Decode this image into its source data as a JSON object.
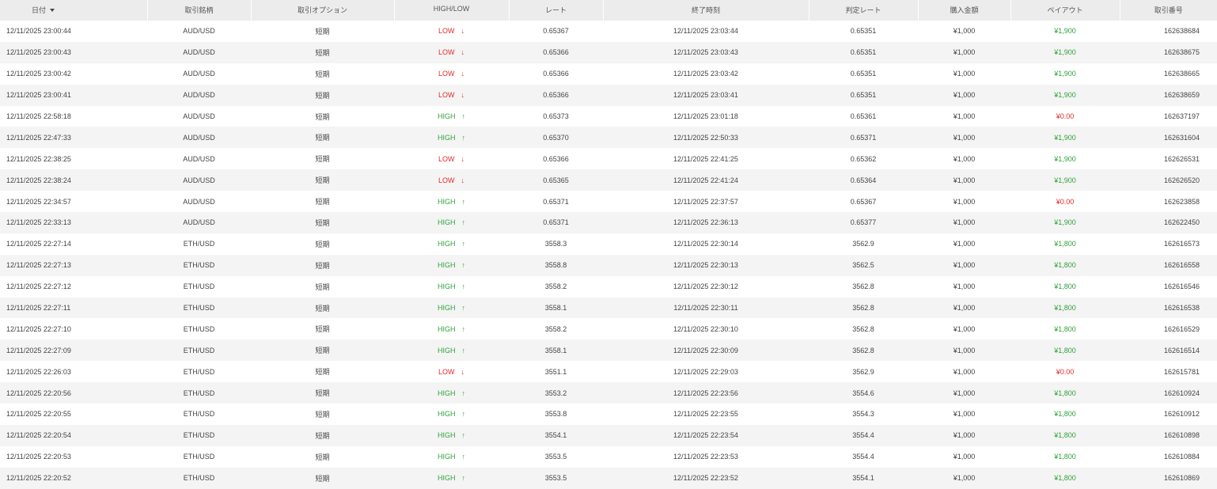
{
  "headers": {
    "date": "日付",
    "pair": "取引銘柄",
    "option": "取引オプション",
    "direction": "HIGH/LOW",
    "rate": "レート",
    "end_time": "終了時刻",
    "judge_rate": "判定レート",
    "amount": "購入金額",
    "payout": "ペイアウト",
    "trade_id": "取引番号"
  },
  "colors": {
    "high": "#2fa33a",
    "low": "#e02a2a",
    "header_bg": "#ececec",
    "row_alt": "#f4f4f4"
  },
  "icons": {
    "sort": "sort-down-icon",
    "high": "arrow-up-icon",
    "low": "arrow-down-icon"
  },
  "rows": [
    {
      "date": "12/11/2025 23:00:44",
      "pair": "AUD/USD",
      "option": "短期",
      "direction": "LOW",
      "arrow": "↓",
      "rate": "0.65367",
      "end_time": "12/11/2025 23:03:44",
      "judge_rate": "0.65351",
      "amount": "¥1,000",
      "payout": "¥1,900",
      "win": true,
      "trade_id": "162638684"
    },
    {
      "date": "12/11/2025 23:00:43",
      "pair": "AUD/USD",
      "option": "短期",
      "direction": "LOW",
      "arrow": "↓",
      "rate": "0.65366",
      "end_time": "12/11/2025 23:03:43",
      "judge_rate": "0.65351",
      "amount": "¥1,000",
      "payout": "¥1,900",
      "win": true,
      "trade_id": "162638675"
    },
    {
      "date": "12/11/2025 23:00:42",
      "pair": "AUD/USD",
      "option": "短期",
      "direction": "LOW",
      "arrow": "↓",
      "rate": "0.65366",
      "end_time": "12/11/2025 23:03:42",
      "judge_rate": "0.65351",
      "amount": "¥1,000",
      "payout": "¥1,900",
      "win": true,
      "trade_id": "162638665"
    },
    {
      "date": "12/11/2025 23:00:41",
      "pair": "AUD/USD",
      "option": "短期",
      "direction": "LOW",
      "arrow": "↓",
      "rate": "0.65366",
      "end_time": "12/11/2025 23:03:41",
      "judge_rate": "0.65351",
      "amount": "¥1,000",
      "payout": "¥1,900",
      "win": true,
      "trade_id": "162638659"
    },
    {
      "date": "12/11/2025 22:58:18",
      "pair": "AUD/USD",
      "option": "短期",
      "direction": "HIGH",
      "arrow": "↑",
      "rate": "0.65373",
      "end_time": "12/11/2025 23:01:18",
      "judge_rate": "0.65361",
      "amount": "¥1,000",
      "payout": "¥0.00",
      "win": false,
      "trade_id": "162637197"
    },
    {
      "date": "12/11/2025 22:47:33",
      "pair": "AUD/USD",
      "option": "短期",
      "direction": "HIGH",
      "arrow": "↑",
      "rate": "0.65370",
      "end_time": "12/11/2025 22:50:33",
      "judge_rate": "0.65371",
      "amount": "¥1,000",
      "payout": "¥1,900",
      "win": true,
      "trade_id": "162631604"
    },
    {
      "date": "12/11/2025 22:38:25",
      "pair": "AUD/USD",
      "option": "短期",
      "direction": "LOW",
      "arrow": "↓",
      "rate": "0.65366",
      "end_time": "12/11/2025 22:41:25",
      "judge_rate": "0.65362",
      "amount": "¥1,000",
      "payout": "¥1,900",
      "win": true,
      "trade_id": "162626531"
    },
    {
      "date": "12/11/2025 22:38:24",
      "pair": "AUD/USD",
      "option": "短期",
      "direction": "LOW",
      "arrow": "↓",
      "rate": "0.65365",
      "end_time": "12/11/2025 22:41:24",
      "judge_rate": "0.65364",
      "amount": "¥1,000",
      "payout": "¥1,900",
      "win": true,
      "trade_id": "162626520"
    },
    {
      "date": "12/11/2025 22:34:57",
      "pair": "AUD/USD",
      "option": "短期",
      "direction": "HIGH",
      "arrow": "↑",
      "rate": "0.65371",
      "end_time": "12/11/2025 22:37:57",
      "judge_rate": "0.65367",
      "amount": "¥1,000",
      "payout": "¥0.00",
      "win": false,
      "trade_id": "162623858"
    },
    {
      "date": "12/11/2025 22:33:13",
      "pair": "AUD/USD",
      "option": "短期",
      "direction": "HIGH",
      "arrow": "↑",
      "rate": "0.65371",
      "end_time": "12/11/2025 22:36:13",
      "judge_rate": "0.65377",
      "amount": "¥1,000",
      "payout": "¥1,900",
      "win": true,
      "trade_id": "162622450"
    },
    {
      "date": "12/11/2025 22:27:14",
      "pair": "ETH/USD",
      "option": "短期",
      "direction": "HIGH",
      "arrow": "↑",
      "rate": "3558.3",
      "end_time": "12/11/2025 22:30:14",
      "judge_rate": "3562.9",
      "amount": "¥1,000",
      "payout": "¥1,800",
      "win": true,
      "trade_id": "162616573"
    },
    {
      "date": "12/11/2025 22:27:13",
      "pair": "ETH/USD",
      "option": "短期",
      "direction": "HIGH",
      "arrow": "↑",
      "rate": "3558.8",
      "end_time": "12/11/2025 22:30:13",
      "judge_rate": "3562.5",
      "amount": "¥1,000",
      "payout": "¥1,800",
      "win": true,
      "trade_id": "162616558"
    },
    {
      "date": "12/11/2025 22:27:12",
      "pair": "ETH/USD",
      "option": "短期",
      "direction": "HIGH",
      "arrow": "↑",
      "rate": "3558.2",
      "end_time": "12/11/2025 22:30:12",
      "judge_rate": "3562.8",
      "amount": "¥1,000",
      "payout": "¥1,800",
      "win": true,
      "trade_id": "162616546"
    },
    {
      "date": "12/11/2025 22:27:11",
      "pair": "ETH/USD",
      "option": "短期",
      "direction": "HIGH",
      "arrow": "↑",
      "rate": "3558.1",
      "end_time": "12/11/2025 22:30:11",
      "judge_rate": "3562.8",
      "amount": "¥1,000",
      "payout": "¥1,800",
      "win": true,
      "trade_id": "162616538"
    },
    {
      "date": "12/11/2025 22:27:10",
      "pair": "ETH/USD",
      "option": "短期",
      "direction": "HIGH",
      "arrow": "↑",
      "rate": "3558.2",
      "end_time": "12/11/2025 22:30:10",
      "judge_rate": "3562.8",
      "amount": "¥1,000",
      "payout": "¥1,800",
      "win": true,
      "trade_id": "162616529"
    },
    {
      "date": "12/11/2025 22:27:09",
      "pair": "ETH/USD",
      "option": "短期",
      "direction": "HIGH",
      "arrow": "↑",
      "rate": "3558.1",
      "end_time": "12/11/2025 22:30:09",
      "judge_rate": "3562.8",
      "amount": "¥1,000",
      "payout": "¥1,800",
      "win": true,
      "trade_id": "162616514"
    },
    {
      "date": "12/11/2025 22:26:03",
      "pair": "ETH/USD",
      "option": "短期",
      "direction": "LOW",
      "arrow": "↓",
      "rate": "3551.1",
      "end_time": "12/11/2025 22:29:03",
      "judge_rate": "3562.9",
      "amount": "¥1,000",
      "payout": "¥0.00",
      "win": false,
      "trade_id": "162615781"
    },
    {
      "date": "12/11/2025 22:20:56",
      "pair": "ETH/USD",
      "option": "短期",
      "direction": "HIGH",
      "arrow": "↑",
      "rate": "3553.2",
      "end_time": "12/11/2025 22:23:56",
      "judge_rate": "3554.6",
      "amount": "¥1,000",
      "payout": "¥1,800",
      "win": true,
      "trade_id": "162610924"
    },
    {
      "date": "12/11/2025 22:20:55",
      "pair": "ETH/USD",
      "option": "短期",
      "direction": "HIGH",
      "arrow": "↑",
      "rate": "3553.8",
      "end_time": "12/11/2025 22:23:55",
      "judge_rate": "3554.3",
      "amount": "¥1,000",
      "payout": "¥1,800",
      "win": true,
      "trade_id": "162610912"
    },
    {
      "date": "12/11/2025 22:20:54",
      "pair": "ETH/USD",
      "option": "短期",
      "direction": "HIGH",
      "arrow": "↑",
      "rate": "3554.1",
      "end_time": "12/11/2025 22:23:54",
      "judge_rate": "3554.4",
      "amount": "¥1,000",
      "payout": "¥1,800",
      "win": true,
      "trade_id": "162610898"
    },
    {
      "date": "12/11/2025 22:20:53",
      "pair": "ETH/USD",
      "option": "短期",
      "direction": "HIGH",
      "arrow": "↑",
      "rate": "3553.5",
      "end_time": "12/11/2025 22:23:53",
      "judge_rate": "3554.4",
      "amount": "¥1,000",
      "payout": "¥1,800",
      "win": true,
      "trade_id": "162610884"
    },
    {
      "date": "12/11/2025 22:20:52",
      "pair": "ETH/USD",
      "option": "短期",
      "direction": "HIGH",
      "arrow": "↑",
      "rate": "3553.5",
      "end_time": "12/11/2025 22:23:52",
      "judge_rate": "3554.1",
      "amount": "¥1,000",
      "payout": "¥1,800",
      "win": true,
      "trade_id": "162610869"
    }
  ]
}
